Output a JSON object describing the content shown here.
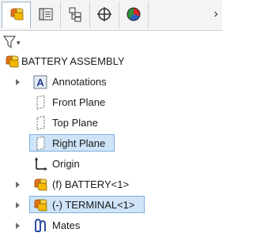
{
  "toolbar": {
    "tabs": [
      {
        "icon": "feature-manager-icon",
        "active": true
      },
      {
        "icon": "property-manager-icon",
        "active": false
      },
      {
        "icon": "configuration-manager-icon",
        "active": false
      },
      {
        "icon": "dimxpert-manager-icon",
        "active": false
      },
      {
        "icon": "display-manager-icon",
        "active": false
      }
    ],
    "more_icon": "›"
  },
  "filter": {
    "icon": "filter-icon",
    "caret": "▾"
  },
  "tree": {
    "root": "BATTERY ASSEMBLY",
    "items": [
      {
        "label": "Annotations",
        "icon": "annotations-icon",
        "expandable": true
      },
      {
        "label": "Front Plane",
        "icon": "plane-icon",
        "expandable": false
      },
      {
        "label": "Top Plane",
        "icon": "plane-icon",
        "expandable": false
      },
      {
        "label": "Right Plane",
        "icon": "plane-icon",
        "expandable": false,
        "selected": true
      },
      {
        "label": "Origin",
        "icon": "origin-icon",
        "expandable": false
      },
      {
        "label": "(f) BATTERY<1>",
        "icon": "part-icon",
        "expandable": true
      },
      {
        "label": "(-) TERMINAL<1>",
        "icon": "part-icon",
        "expandable": true,
        "selected": true
      },
      {
        "label": "Mates",
        "icon": "mates-icon",
        "expandable": true
      }
    ]
  },
  "colors": {
    "selection_fill": "#cfe4f7",
    "selection_border": "#7fb0e0",
    "part_yellow": "#f5b700",
    "part_orange": "#e8731a"
  }
}
